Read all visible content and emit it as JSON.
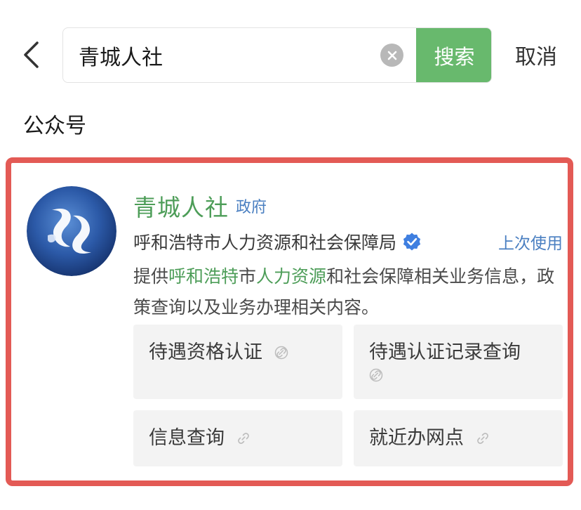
{
  "search": {
    "query": "青城人社",
    "search_label": "搜索",
    "cancel_label": "取消"
  },
  "section": {
    "title": "公众号"
  },
  "result": {
    "name": "青城人社",
    "badge": "政府",
    "org": "呼和浩特市人力资源和社会保障局",
    "recent": "上次使用",
    "description": {
      "p1": "提供",
      "h1": "呼和浩特",
      "p2": "市",
      "h2": "人力资源",
      "p3": "和社会保障相关业务信息，政策查询以及业务办理相关内容。"
    },
    "services": [
      {
        "label": "待遇资格认证"
      },
      {
        "label": "待遇认证记录查询"
      },
      {
        "label": "信息查询"
      },
      {
        "label": "就近办网点"
      }
    ]
  },
  "icons": {
    "back": "chevron-left-icon",
    "clear": "clear-icon",
    "verified": "verified-badge-icon",
    "link": "link-icon",
    "logo": "avatar-logo"
  },
  "colors": {
    "accent_green": "#68b96d",
    "name_green": "#4d9d58",
    "highlight_blue": "#4a7fc1",
    "frame_red": "#e35a55"
  }
}
